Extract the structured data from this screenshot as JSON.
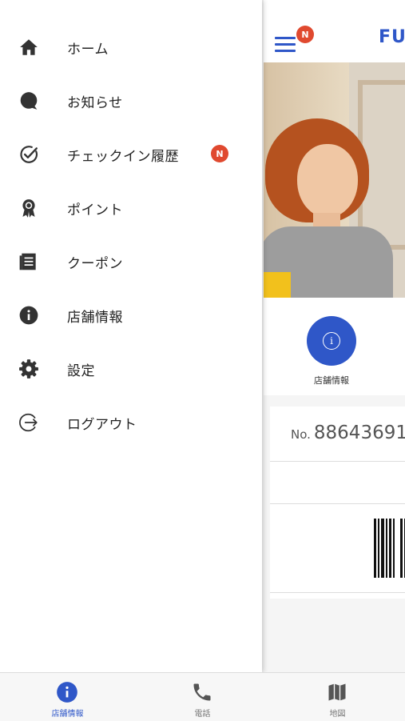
{
  "header": {
    "brand": "FU",
    "menu_badge": "N"
  },
  "main": {
    "info_button_label": "店舗情報",
    "member_number_prefix": "No.",
    "member_number": "88643691"
  },
  "drawer": {
    "items": [
      {
        "label": "ホーム",
        "icon": "home-icon"
      },
      {
        "label": "お知らせ",
        "icon": "chat-bubble-icon"
      },
      {
        "label": "チェックイン履歴",
        "icon": "check-circle-icon",
        "badge": "N"
      },
      {
        "label": "ポイント",
        "icon": "award-ribbon-icon"
      },
      {
        "label": "クーポン",
        "icon": "coupon-list-icon"
      },
      {
        "label": "店舗情報",
        "icon": "info-icon"
      },
      {
        "label": "設定",
        "icon": "gear-icon"
      },
      {
        "label": "ログアウト",
        "icon": "logout-icon"
      }
    ]
  },
  "tabbar": {
    "tabs": [
      {
        "label": "店舗情報",
        "icon": "info-icon",
        "active": true
      },
      {
        "label": "電話",
        "icon": "phone-icon",
        "active": false
      },
      {
        "label": "地図",
        "icon": "map-icon",
        "active": false
      }
    ]
  },
  "colors": {
    "accent": "#2f57c8",
    "badge": "#e0492f"
  }
}
